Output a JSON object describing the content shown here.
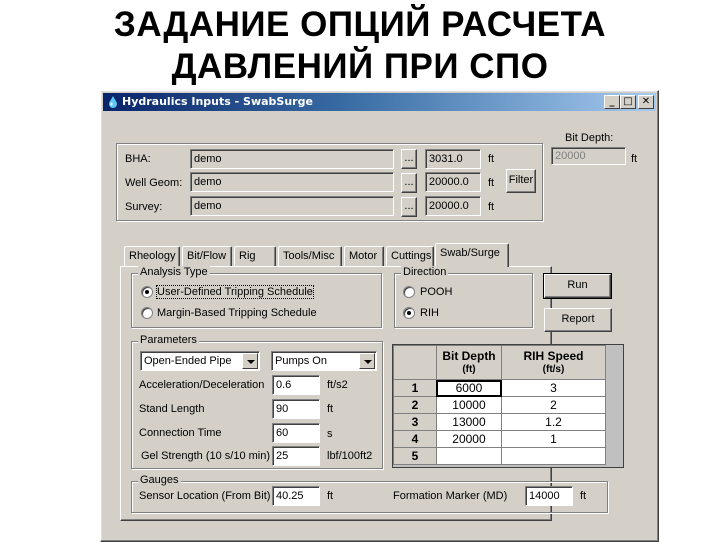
{
  "slide": {
    "title_line1": "ЗАДАНИЕ ОПЦИЙ РАСЧЕТА",
    "title_line2": "ДАВЛЕНИЙ ПРИ СПО"
  },
  "window": {
    "title": "Hydraulics Inputs - SwabSurge",
    "icon": "water-drop-icon",
    "controls": {
      "minimize": "_",
      "maximize": "□",
      "close": "✕"
    }
  },
  "header": {
    "rows": [
      {
        "label": "BHA:",
        "value": "demo",
        "browse": "...",
        "depth": "3031.0",
        "unit": "ft"
      },
      {
        "label": "Well Geom:",
        "value": "demo",
        "browse": "...",
        "depth": "20000.0",
        "unit": "ft"
      },
      {
        "label": "Survey:",
        "value": "demo",
        "browse": "...",
        "depth": "20000.0",
        "unit": "ft"
      }
    ],
    "filter_label": "Filter",
    "bit_depth": {
      "label": "Bit Depth:",
      "value": "20000",
      "unit": "ft"
    }
  },
  "tabs": [
    {
      "label": "Rheology",
      "active": false
    },
    {
      "label": "Bit/Flow",
      "active": false
    },
    {
      "label": "Rig",
      "active": false
    },
    {
      "label": "Tools/Misc",
      "active": false
    },
    {
      "label": "Motor",
      "active": false
    },
    {
      "label": "Cuttings",
      "active": false
    },
    {
      "label": "Swab/Surge",
      "active": true
    }
  ],
  "analysis_type": {
    "title": "Analysis Type",
    "options": [
      {
        "label": "User-Defined Tripping Schedule",
        "selected": true
      },
      {
        "label": "Margin-Based Tripping Schedule",
        "selected": false
      }
    ]
  },
  "direction": {
    "title": "Direction",
    "options": [
      {
        "label": "POOH",
        "selected": false
      },
      {
        "label": "RIH",
        "selected": true
      }
    ]
  },
  "actions": {
    "run": "Run",
    "report": "Report"
  },
  "parameters": {
    "title": "Parameters",
    "pipe_type": "Open-Ended Pipe",
    "pump_state": "Pumps On",
    "fields": [
      {
        "label": "Acceleration/Deceleration",
        "value": "0.6",
        "unit": "ft/s2"
      },
      {
        "label": "Stand Length",
        "value": "90",
        "unit": "ft"
      },
      {
        "label": "Connection Time",
        "value": "60",
        "unit": "s"
      },
      {
        "label": "Gel Strength (10 s/10 min)",
        "value": "25",
        "unit": "lbf/100ft2"
      }
    ]
  },
  "schedule": {
    "columns": [
      {
        "title": "Bit Depth",
        "unit": "(ft)"
      },
      {
        "title": "RIH Speed",
        "unit": "(ft/s)"
      }
    ],
    "rows": [
      {
        "n": "1",
        "depth": "6000",
        "speed": "3"
      },
      {
        "n": "2",
        "depth": "10000",
        "speed": "2"
      },
      {
        "n": "3",
        "depth": "13000",
        "speed": "1.2"
      },
      {
        "n": "4",
        "depth": "20000",
        "speed": "1"
      },
      {
        "n": "5",
        "depth": "",
        "speed": ""
      }
    ]
  },
  "gauges": {
    "title": "Gauges",
    "sensor_label": "Sensor Location (From Bit)",
    "sensor_value": "40.25",
    "sensor_unit": "ft",
    "marker_label": "Formation Marker (MD)",
    "marker_value": "14000",
    "marker_unit": "ft"
  }
}
